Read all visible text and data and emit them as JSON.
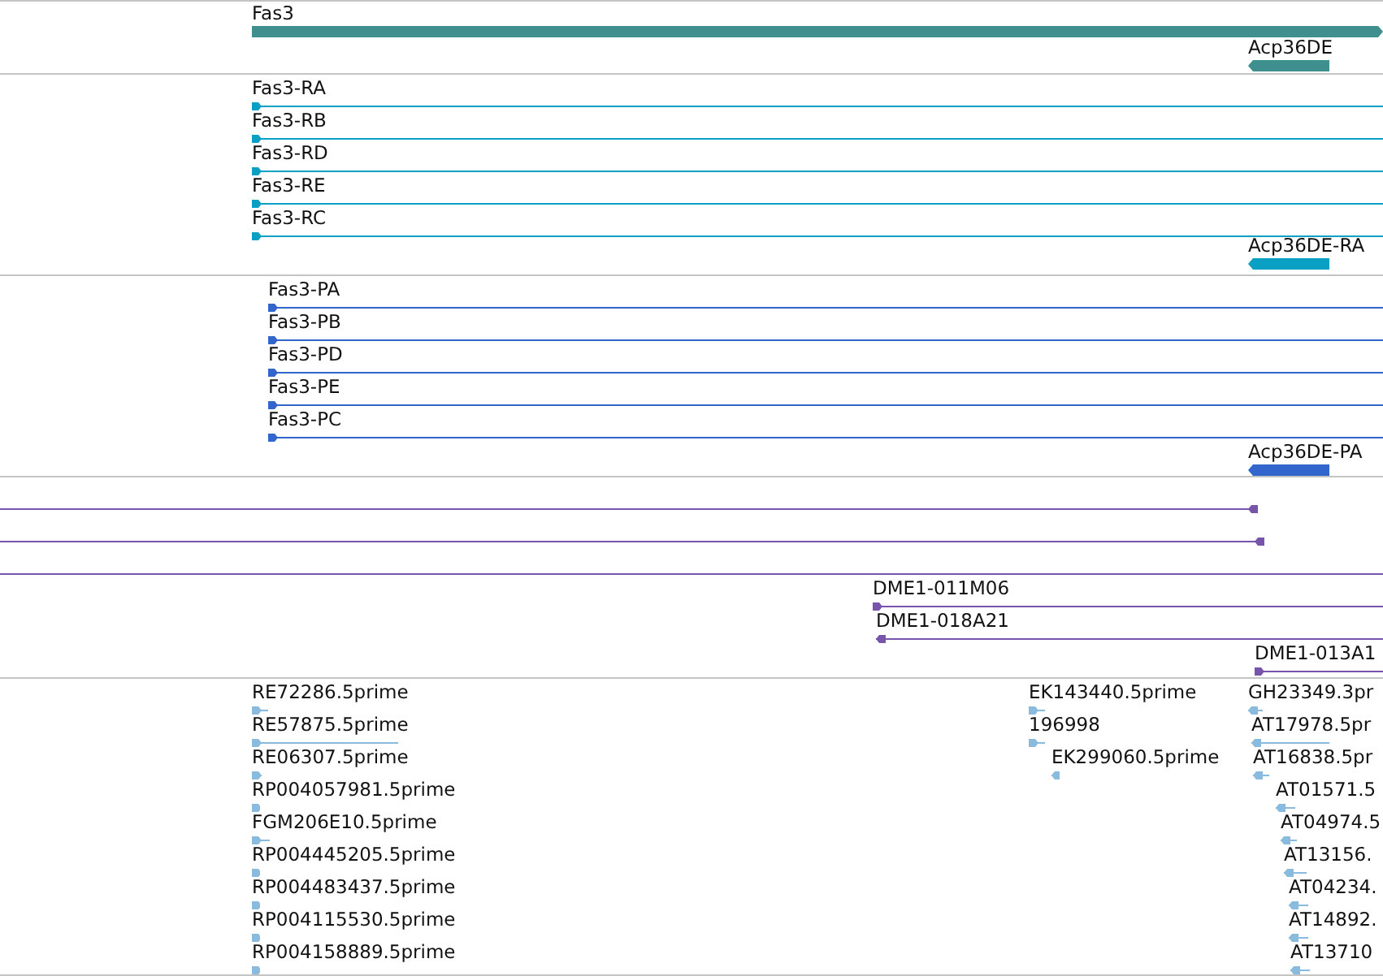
{
  "tracks": [
    {
      "features": [
        {
          "label": "Fas3",
          "kind": "bar",
          "forward": true
        },
        {
          "label": "Acp36DE",
          "kind": "bar",
          "forward": false
        }
      ]
    },
    {
      "features": [
        {
          "label": "Fas3-RA",
          "kind": "arrow",
          "forward": true
        },
        {
          "label": "Fas3-RB",
          "kind": "arrow",
          "forward": true
        },
        {
          "label": "Fas3-RD",
          "kind": "arrow",
          "forward": true
        },
        {
          "label": "Fas3-RE",
          "kind": "arrow",
          "forward": true
        },
        {
          "label": "Fas3-RC",
          "kind": "arrow",
          "forward": true
        },
        {
          "label": "Acp36DE-RA",
          "kind": "bar",
          "forward": false
        }
      ]
    },
    {
      "features": [
        {
          "label": "Fas3-PA",
          "kind": "arrow",
          "forward": true
        },
        {
          "label": "Fas3-PB",
          "kind": "arrow",
          "forward": true
        },
        {
          "label": "Fas3-PD",
          "kind": "arrow",
          "forward": true
        },
        {
          "label": "Fas3-PE",
          "kind": "arrow",
          "forward": true
        },
        {
          "label": "Fas3-PC",
          "kind": "arrow",
          "forward": true
        },
        {
          "label": "Acp36DE-PA",
          "kind": "bar",
          "forward": false
        }
      ]
    },
    {
      "features": [
        {
          "kind": "arrow",
          "forward": false
        },
        {
          "kind": "arrow",
          "forward": false
        },
        {
          "kind": "line"
        },
        {
          "label": "DME1-011M06",
          "kind": "arrow",
          "forward": true
        },
        {
          "label": "DME1-018A21",
          "kind": "arrow",
          "forward": false
        },
        {
          "label": "DME1-013A1",
          "kind": "arrow",
          "forward": true
        }
      ]
    },
    {
      "features": [
        {
          "label": "RE72286.5prime",
          "kind": "arrow",
          "forward": true
        },
        {
          "label": "RE57875.5prime",
          "kind": "arrow",
          "forward": true
        },
        {
          "label": "RE06307.5prime",
          "kind": "arrow",
          "forward": true
        },
        {
          "label": "RP004057981.5prime",
          "kind": "arrow",
          "forward": true
        },
        {
          "label": "FGM206E10.5prime",
          "kind": "arrow",
          "forward": true
        },
        {
          "label": "RP004445205.5prime",
          "kind": "arrow",
          "forward": true
        },
        {
          "label": "RP004483437.5prime",
          "kind": "arrow",
          "forward": true
        },
        {
          "label": "RP004115530.5prime",
          "kind": "arrow",
          "forward": true
        },
        {
          "label": "RP004158889.5prime",
          "kind": "arrow",
          "forward": true
        },
        {
          "label": "EK143440.5prime",
          "kind": "arrow",
          "forward": true
        },
        {
          "label": "196998",
          "kind": "arrow",
          "forward": true
        },
        {
          "label": "EK299060.5prime",
          "kind": "arrow",
          "forward": false
        },
        {
          "label": "GH23349.3pr",
          "kind": "arrow",
          "forward": false
        },
        {
          "label": "AT17978.5pr",
          "kind": "arrow",
          "forward": false
        },
        {
          "label": "AT16838.5pr",
          "kind": "arrow",
          "forward": false
        },
        {
          "label": "AT01571.5",
          "kind": "arrow",
          "forward": false
        },
        {
          "label": "AT04974.5",
          "kind": "arrow",
          "forward": false
        },
        {
          "label": "AT13156.",
          "kind": "arrow",
          "forward": false
        },
        {
          "label": "AT04234.",
          "kind": "arrow",
          "forward": false
        },
        {
          "label": "AT14892.",
          "kind": "arrow",
          "forward": false
        },
        {
          "label": "AT13710",
          "kind": "arrow",
          "forward": false
        }
      ]
    }
  ]
}
